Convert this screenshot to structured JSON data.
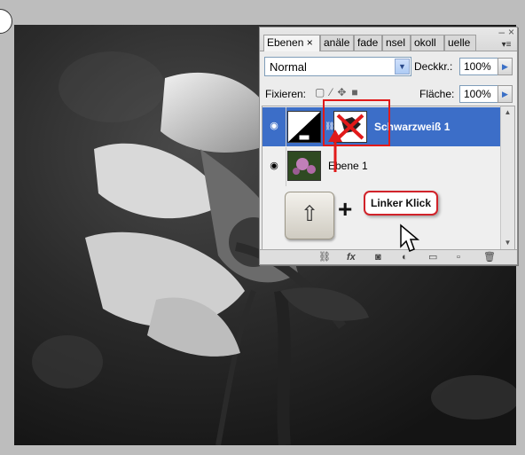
{
  "panel": {
    "tabs": [
      "Ebenen",
      "anäle",
      "fade",
      "nsel",
      "okoll",
      "uelle"
    ],
    "active_tab_close": "×",
    "minimize": "–",
    "close": "×",
    "menu_icon": "panel-menu-icon",
    "blend_mode": "Normal",
    "opacity_label": "Deckkr.:",
    "opacity_value": "100%",
    "lock_label": "Fixieren:",
    "fill_label": "Fläche:",
    "fill_value": "100%"
  },
  "layers": [
    {
      "name": "Schwarzweiß 1",
      "selected": true
    },
    {
      "name": "Ebene 1",
      "selected": false
    }
  ],
  "overlay": {
    "key_symbol": "⇧",
    "plus": "+",
    "callout": "Linker Klick"
  },
  "colors": {
    "selection": "#3c6ec8",
    "annotation_red": "#e11a1a"
  }
}
